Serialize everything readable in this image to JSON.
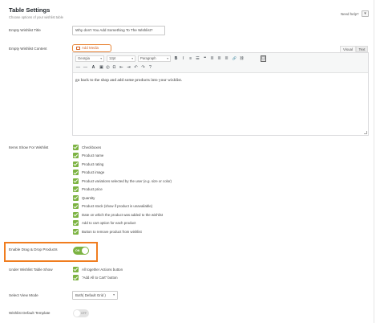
{
  "header": {
    "title": "Table Settings",
    "subtitle": "Choose options of your wishlist table",
    "help_text": "Need help?",
    "help_icon": "question-icon"
  },
  "fields": {
    "empty_title": {
      "label": "Empty Wishlist Title",
      "value": "Why don't You Add Something To The Wishlist?"
    },
    "empty_content": {
      "label": "Empty Wishlist Content",
      "add_media": "Add Media",
      "tabs": {
        "visual": "Visual",
        "text": "Text"
      },
      "toolbar": {
        "font_family": "Georgia",
        "font_size": "12pt",
        "format": "Paragraph",
        "row1_icons": [
          "B",
          "I",
          "≡",
          "☰",
          "❝",
          "≣",
          "≣",
          "≣",
          "🔗",
          "⛓",
          "☐"
        ],
        "row2_icons": [
          "—",
          "—",
          "A",
          "▣",
          "◎",
          "Ω",
          "⇤",
          "⇥",
          "↶",
          "↷",
          "?"
        ]
      },
      "body": "go back to the shop and add some products into your wishlist."
    },
    "items_show": {
      "label": "Items Show For Wishlist",
      "options": [
        "Checkboxes",
        "Product name",
        "Product rating",
        "Product image",
        "Product variations selected by the user (e.g. size or color)",
        "Product price",
        "Quantity",
        "Product stock (show if product is unavailable)",
        "Date on which the product was added to the wishlist",
        "Add to cart option for each product",
        "Button to remove product from wishlist"
      ]
    },
    "drag_drop": {
      "label": "Enable Drag & Drop Products",
      "toggle_text": "ON",
      "state": "on"
    },
    "under_table": {
      "label": "Under Wishlist Table Show",
      "options": [
        "All together Actions button",
        "\"Add All to Cart\" button"
      ]
    },
    "view_mode": {
      "label": "Select View Mode",
      "selected": "Both( Default Grid )"
    },
    "default_template": {
      "label": "Wishlist Default Template",
      "toggle_text": "OFF",
      "state": "off"
    }
  },
  "colors": {
    "accent_green": "#7cb342",
    "highlight_orange": "#f07d1f",
    "add_media_orange": "#d4652a"
  }
}
